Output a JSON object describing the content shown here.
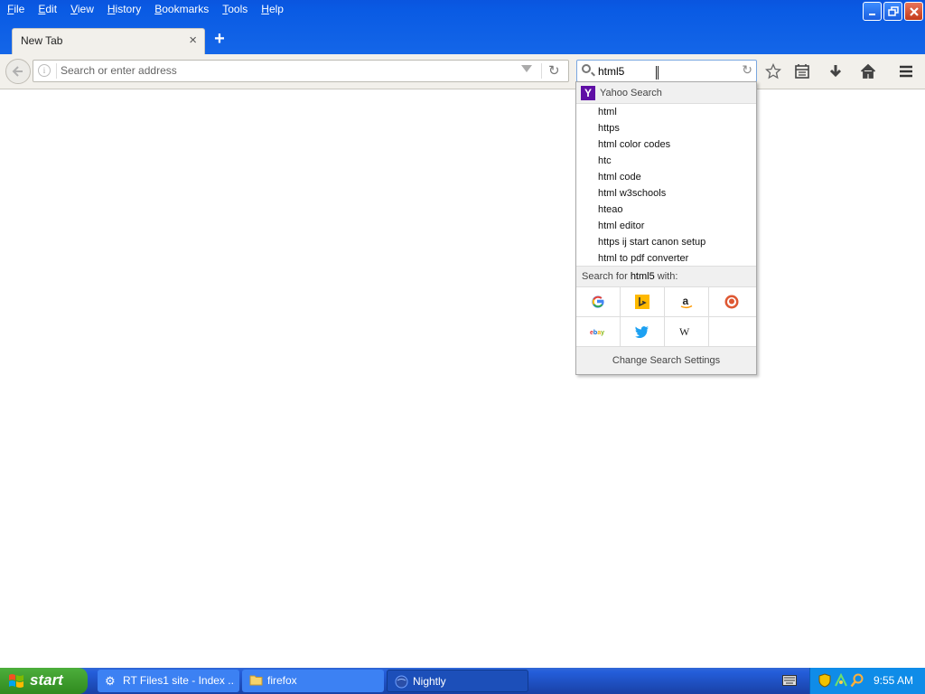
{
  "menu": [
    {
      "mnemonic": "F",
      "rest": "ile"
    },
    {
      "mnemonic": "E",
      "rest": "dit"
    },
    {
      "mnemonic": "V",
      "rest": "iew"
    },
    {
      "mnemonic": "H",
      "rest": "istory"
    },
    {
      "mnemonic": "B",
      "rest": "ookmarks"
    },
    {
      "mnemonic": "T",
      "rest": "ools"
    },
    {
      "mnemonic": "H",
      "rest": "elp"
    }
  ],
  "tab": {
    "label": "New Tab",
    "close": "×"
  },
  "new_tab": "+",
  "urlbar": {
    "placeholder": "Search or enter address"
  },
  "searchbar": {
    "value": "html5"
  },
  "search_popup": {
    "engine_name": "Yahoo Search",
    "engine_logo": "Y",
    "suggestions": [
      "html",
      "https",
      "html color codes",
      "htc",
      "html code",
      "html w3schools",
      "hteao",
      "html editor",
      "https ij start canon setup",
      "html to pdf converter"
    ],
    "search_for_prefix": "Search for ",
    "search_for_term": "html5",
    "search_for_suffix": " with:",
    "engines_row1": [
      "google-icon",
      "bing-icon",
      "amazon-icon",
      "duckduckgo-icon"
    ],
    "engines_row2": [
      "ebay-icon",
      "twitter-icon",
      "wikipedia-icon"
    ],
    "change_settings": "Change Search Settings"
  },
  "taskbar": {
    "start_label": "start",
    "tasks": [
      {
        "label": "RT Files1 site - Index ...",
        "icon": "gear-icon"
      },
      {
        "label": "firefox",
        "icon": "folder-icon"
      },
      {
        "label": "Nightly",
        "icon": "nightly-globe-icon"
      }
    ],
    "clock": "9:55 AM"
  },
  "colors": {
    "titlebar": "#0a55df",
    "yahoo": "#5f0fa5",
    "taskbar": "#245edb",
    "start": "#308a1f"
  }
}
